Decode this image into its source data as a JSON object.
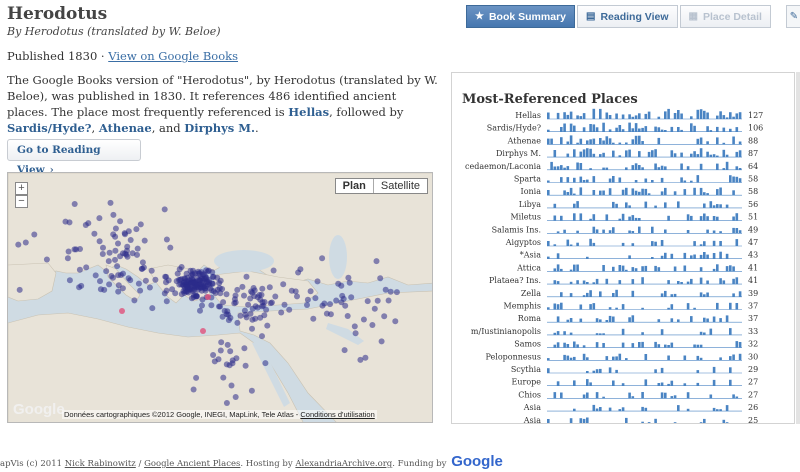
{
  "book": {
    "title": "Herodotus",
    "byline": "By Herodotus (translated by W. Beloe)",
    "published": "Published 1830 · ",
    "google_books_link": "View on Google Books",
    "summary_1": "The Google Books version of \"Herodotus\", by Herodotus (translated by W. Beloe), was published in 1830. It references 486 identified ancient places. The place most frequently referenced is ",
    "top_place_1": "Hellas",
    "summary_2": ", followed by ",
    "top_place_2": "Sardis/Hyde?",
    "sep_1": ", ",
    "top_place_3": "Athenae",
    "sep_2": ", and ",
    "top_place_4": "Dirphys M.",
    "summary_end": ".",
    "reading_button": "Go to Reading View",
    "reading_button_chevron": "›"
  },
  "tabs": [
    {
      "label": "Book Summary",
      "icon": "star-icon",
      "glyph": "★",
      "state": "active"
    },
    {
      "label": "Reading View",
      "icon": "book-icon",
      "glyph": "▤",
      "state": "normal"
    },
    {
      "label": "Place Detail",
      "icon": "map-icon",
      "glyph": "▦",
      "state": "disabled"
    }
  ],
  "tab_extra_glyph": "✎",
  "map": {
    "zoom_in": "+",
    "zoom_out": "−",
    "type_plan": "Plan",
    "type_satellite": "Satellite",
    "logo": "Google",
    "attribution": "Données cartographiques ©2012 Google, INEGI, MapLink, Tele Atlas - ",
    "terms": "Conditions d'utilisation",
    "dot_color": "#2b2b8a",
    "highlight_color": "#e0507a"
  },
  "chart_data": {
    "type": "bar",
    "title": "Most-Referenced Places",
    "bar_color": "#4a84c3",
    "categories": [
      "Hellas",
      "Sardis/Hyde?",
      "Athenae",
      "Dirphys M.",
      "Lacedaemon/Laconia",
      "Sparta",
      "Ionia",
      "Libya",
      "Miletus",
      "Salamis Ins.",
      "Aigyptos",
      "*Asia",
      "Attica",
      "Plataea? Ins.",
      "Zella",
      "Memphis",
      "Roma",
      "Byzantium/Iustinianopolis",
      "Samos",
      "Peloponnesus",
      "Scythia",
      "Europe",
      "Chios",
      "Asia",
      "Asia"
    ],
    "category_labels_shown": [
      "Hellas",
      "Sardis/Hyde?",
      "Athenae",
      "Dirphys M.",
      "cedaemon/Laconia",
      "Sparta",
      "Ionia",
      "Libya",
      "Miletus",
      "Salamis Ins.",
      "Aigyptos",
      "*Asia",
      "Attica",
      "Plataea? Ins.",
      "Zella",
      "Memphis",
      "Roma",
      "m/Iustinianopolis",
      "Samos",
      "Peloponnesus",
      "Scythia",
      "Europe",
      "Chios",
      "Asia",
      "Asia"
    ],
    "values": [
      127,
      106,
      88,
      87,
      64,
      58,
      58,
      56,
      51,
      49,
      47,
      43,
      41,
      41,
      39,
      37,
      37,
      33,
      32,
      30,
      29,
      27,
      27,
      26,
      25
    ]
  },
  "footer": {
    "prefix": "apVis (c) 2011 ",
    "author": "Nick Rabinowitz",
    "sep": " / ",
    "project": "Google Ancient Places",
    "hosting": ". Hosting by ",
    "host": "AlexandriaArchive.org",
    "funding": ". Funding by ",
    "funder": "Google"
  }
}
